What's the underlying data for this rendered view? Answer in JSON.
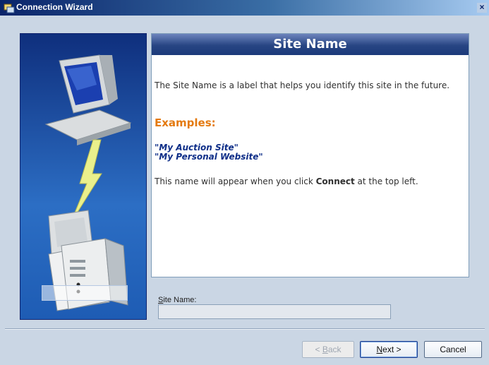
{
  "window": {
    "title": "Connection Wizard",
    "close_symbol": "×",
    "icon": "wizard-icon"
  },
  "header": {
    "title": "Site Name"
  },
  "content": {
    "intro": "The Site Name is a label that helps you identify this site in the future.",
    "examples_heading": "Examples:",
    "examples": [
      "\"My Auction Site\"",
      "\"My Personal Website\""
    ],
    "appear_prefix": "This name will appear when you click ",
    "appear_bold": "Connect",
    "appear_suffix": " at the top left."
  },
  "site_name": {
    "label_ul": "S",
    "label_rest": "ite Name:",
    "value": ""
  },
  "buttons": {
    "back_prefix": "< ",
    "back_ul": "B",
    "back_rest": "ack",
    "next_ul": "N",
    "next_rest": "ext >",
    "cancel": "Cancel"
  },
  "colors": {
    "header": "#274583",
    "examples_heading": "#e47a10",
    "example_text": "#0e2e88"
  }
}
